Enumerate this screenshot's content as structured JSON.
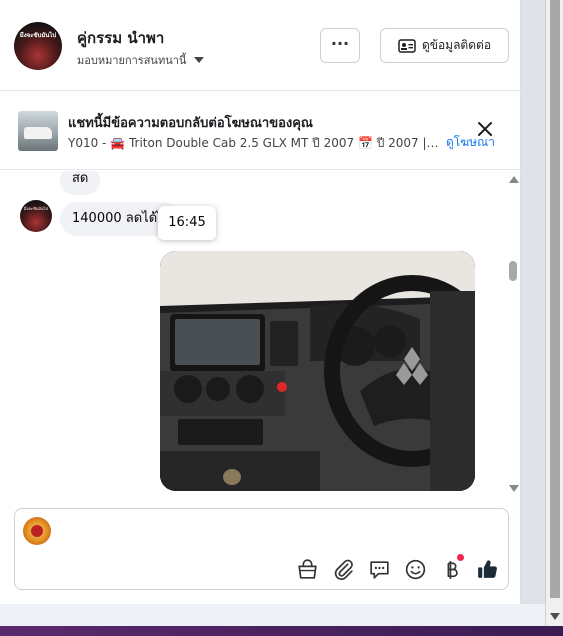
{
  "header": {
    "contact_name": "คู่กรรม นำพา",
    "assign_label": "มอบหมายการสนทนานี้",
    "more_label": "···",
    "info_button_label": "ดูข้อมูลติดต่อ",
    "avatar_text": "มีงจะขับมันไป"
  },
  "ad": {
    "title": "แชทนี้มีข้อความตอบกลับต่อโฆษณาของคุณ",
    "subtitle": "Y010 - 🚘 Triton Double Cab 2.5 GLX MT ปี 2007 📅 ปี 2007 | ⚙️ เ...",
    "view_ad_label": "ดูโฆษณา"
  },
  "messages": [
    {
      "text": "สด"
    },
    {
      "text": "140000  ลดได้ไ"
    }
  ],
  "tooltip_time": "16:45",
  "composer": {
    "tools": [
      "bag-icon",
      "paperclip-icon",
      "chat-bubble-icon",
      "emoji-icon",
      "baht-icon",
      "thumbs-up-icon"
    ]
  },
  "colors": {
    "accent": "#1877f2",
    "bubble": "#f0f2f5",
    "badge": "#f02849"
  }
}
